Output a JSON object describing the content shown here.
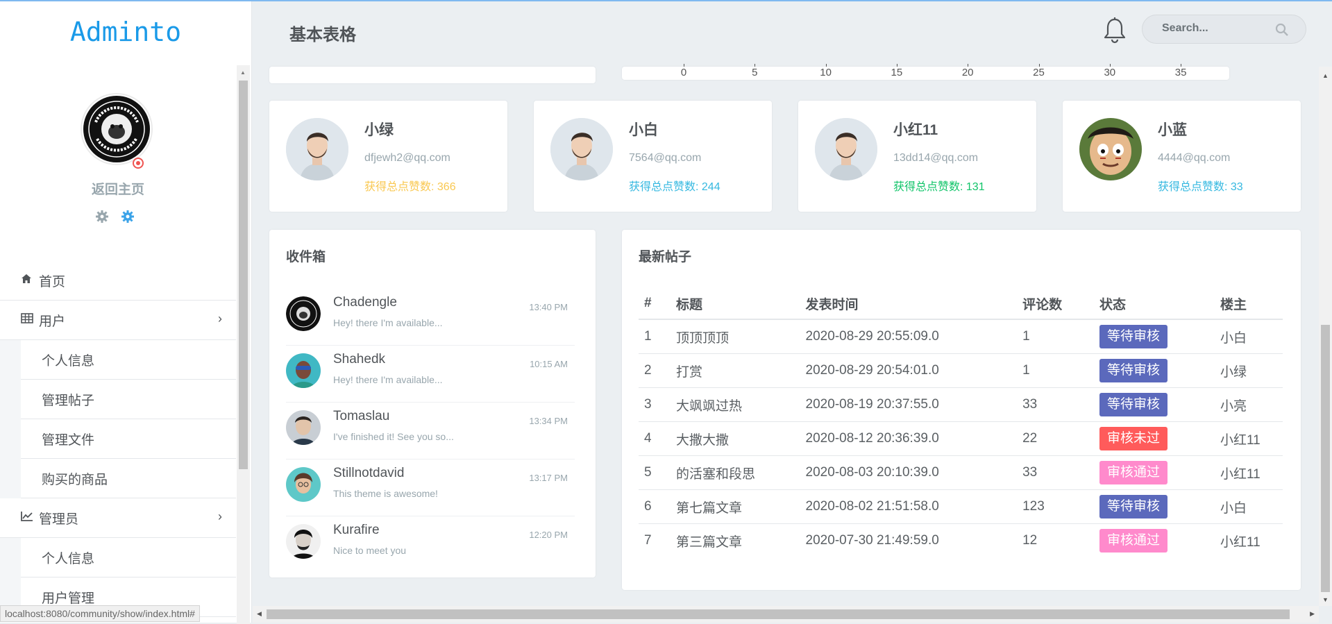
{
  "app": {
    "logo": "Adminto",
    "page_title": "基本表格"
  },
  "sidebar": {
    "home_link": "返回主页",
    "menu": [
      {
        "label": "首页",
        "icon": "home-icon"
      },
      {
        "label": "用户",
        "icon": "table-icon"
      },
      {
        "label": "个人信息"
      },
      {
        "label": "管理帖子"
      },
      {
        "label": "管理文件"
      },
      {
        "label": "购买的商品"
      },
      {
        "label": "管理员",
        "icon": "line-chart-icon"
      },
      {
        "label": "个人信息"
      },
      {
        "label": "用户管理"
      }
    ]
  },
  "search": {
    "placeholder": "Search..."
  },
  "chart_axis": {
    "ticks": [
      "0",
      "5",
      "10",
      "15",
      "20",
      "25",
      "30",
      "35"
    ]
  },
  "users": [
    {
      "name": "小绿",
      "email": "dfjewh2@qq.com",
      "likes": "获得总点赞数: 366",
      "color": "#f9c851"
    },
    {
      "name": "小白",
      "email": "7564@qq.com",
      "likes": "获得总点赞数: 244",
      "color": "#35b8e0"
    },
    {
      "name": "小红11",
      "email": "13dd14@qq.com",
      "likes": "获得总点赞数: 131",
      "color": "#10c469"
    },
    {
      "name": "小蓝",
      "email": "4444@qq.com",
      "likes": "获得总点赞数: 33",
      "color": "#35b8e0"
    }
  ],
  "inbox": {
    "title": "收件箱",
    "items": [
      {
        "name": "Chadengle",
        "message": "Hey! there I'm available...",
        "time": "13:40 PM"
      },
      {
        "name": "Shahedk",
        "message": "Hey! there I'm available...",
        "time": "10:15 AM"
      },
      {
        "name": "Tomaslau",
        "message": "I've finished it! See you so...",
        "time": "13:34 PM"
      },
      {
        "name": "Stillnotdavid",
        "message": "This theme is awesome!",
        "time": "13:17 PM"
      },
      {
        "name": "Kurafire",
        "message": "Nice to meet you",
        "time": "12:20 PM"
      }
    ]
  },
  "posts": {
    "title": "最新帖子",
    "columns": [
      "#",
      "标题",
      "发表时间",
      "评论数",
      "状态",
      "楼主"
    ],
    "rows": [
      {
        "id": "1",
        "title": "顶顶顶顶",
        "time": "2020-08-29 20:55:09.0",
        "comments": "1",
        "status": "等待审核",
        "author": "小白"
      },
      {
        "id": "2",
        "title": "打赏",
        "time": "2020-08-29 20:54:01.0",
        "comments": "1",
        "status": "等待审核",
        "author": "小绿"
      },
      {
        "id": "3",
        "title": "大飒飒过热",
        "time": "2020-08-19 20:37:55.0",
        "comments": "33",
        "status": "等待审核",
        "author": "小亮"
      },
      {
        "id": "4",
        "title": "大撒大撒",
        "time": "2020-08-12 20:36:39.0",
        "comments": "22",
        "status": "审核未过",
        "author": "小红11"
      },
      {
        "id": "5",
        "title": "的活塞和段思",
        "time": "2020-08-03 20:10:39.0",
        "comments": "33",
        "status": "审核通过",
        "author": "小红11"
      },
      {
        "id": "6",
        "title": "第七篇文章",
        "time": "2020-08-02 21:51:58.0",
        "comments": "123",
        "status": "等待审核",
        "author": "小白"
      },
      {
        "id": "7",
        "title": "第三篇文章",
        "time": "2020-07-30 21:49:59.0",
        "comments": "12",
        "status": "审核通过",
        "author": "小红11"
      }
    ],
    "status_colors": {
      "等待审核": "#5b69bc",
      "审核未过": "#ff5b5b",
      "审核通过": "#ff8acc"
    }
  },
  "browser": {
    "status_url": "localhost:8080/community/show/index.html#"
  }
}
